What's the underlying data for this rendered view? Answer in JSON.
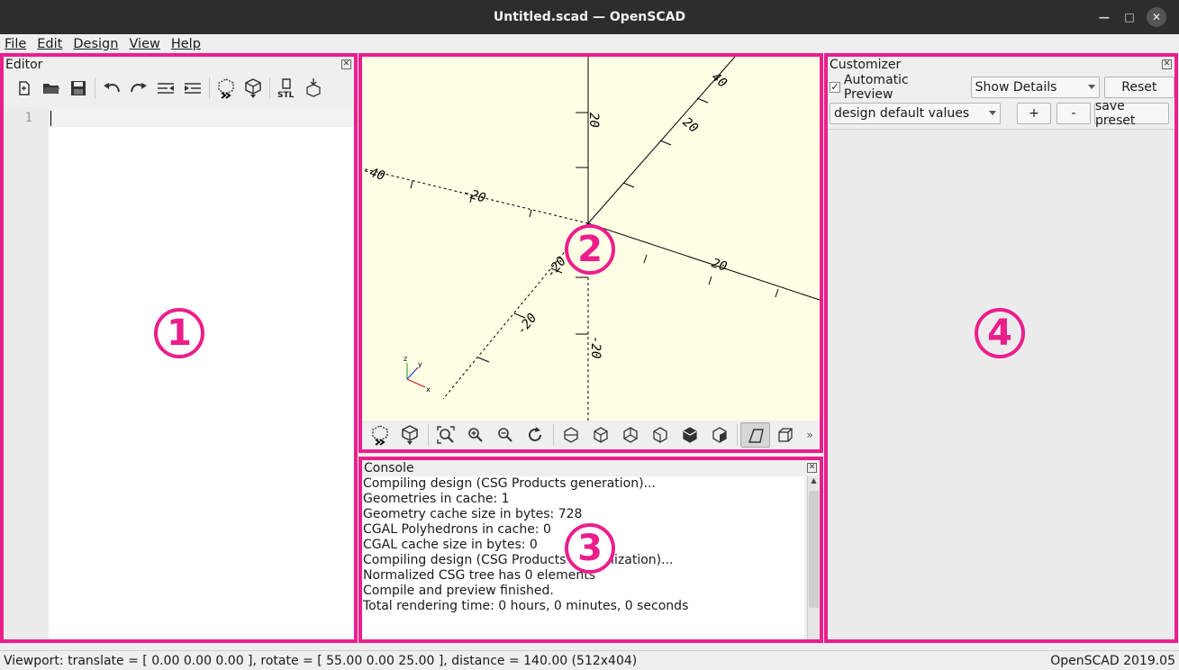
{
  "window": {
    "title": "Untitled.scad — OpenSCAD"
  },
  "menu": [
    "File",
    "Edit",
    "Design",
    "View",
    "Help"
  ],
  "editor": {
    "title": "Editor",
    "toolbar_icons": [
      "new-file-icon",
      "open-file-icon",
      "save-icon",
      "undo-icon",
      "redo-icon",
      "unindent-icon",
      "indent-icon",
      "preview-icon",
      "render-icon",
      "export-stl-icon",
      "send-to-print-icon"
    ],
    "line_numbers": [
      "1"
    ],
    "code": ""
  },
  "viewport": {
    "axis_labels": [
      "20",
      "40",
      "20",
      "20",
      "-20",
      "-40",
      "-20",
      "-20",
      "-20"
    ],
    "toolbar_icons": [
      "preview-icon",
      "render-icon",
      "view-all-icon",
      "zoom-in-icon",
      "zoom-out-icon",
      "reset-view-icon",
      "view-right-icon",
      "view-top-icon",
      "view-bottom-icon",
      "view-left-icon",
      "view-front-icon",
      "view-back-icon",
      "perspective-icon",
      "orthogonal-icon",
      "more-icon"
    ],
    "more": "»"
  },
  "console": {
    "title": "Console",
    "lines": [
      "Compiling design (CSG Products generation)...",
      "Geometries in cache: 1",
      "Geometry cache size in bytes: 728",
      "CGAL Polyhedrons in cache: 0",
      "CGAL cache size in bytes: 0",
      "Compiling design (CSG Products normalization)...",
      "Normalized CSG tree has 0 elements",
      "Compile and preview finished.",
      "Total rendering time: 0 hours, 0 minutes, 0 seconds"
    ]
  },
  "customizer": {
    "title": "Customizer",
    "auto_preview_label": "Automatic Preview",
    "auto_preview_checked": "✓",
    "details_value": "Show Details",
    "reset_label": "Reset",
    "preset_value": "design default values",
    "add_label": "+",
    "remove_label": "-",
    "save_preset_label": "save preset"
  },
  "status": {
    "viewport": "Viewport: translate = [ 0.00 0.00 0.00 ], rotate = [ 55.00 0.00 25.00 ], distance = 140.00 (512x404)",
    "version": "OpenSCAD 2019.05"
  },
  "annotations": [
    "1",
    "2",
    "3",
    "4"
  ],
  "colors": {
    "highlight": "#ec1e8c",
    "viewport_bg": "#ffffe5"
  }
}
